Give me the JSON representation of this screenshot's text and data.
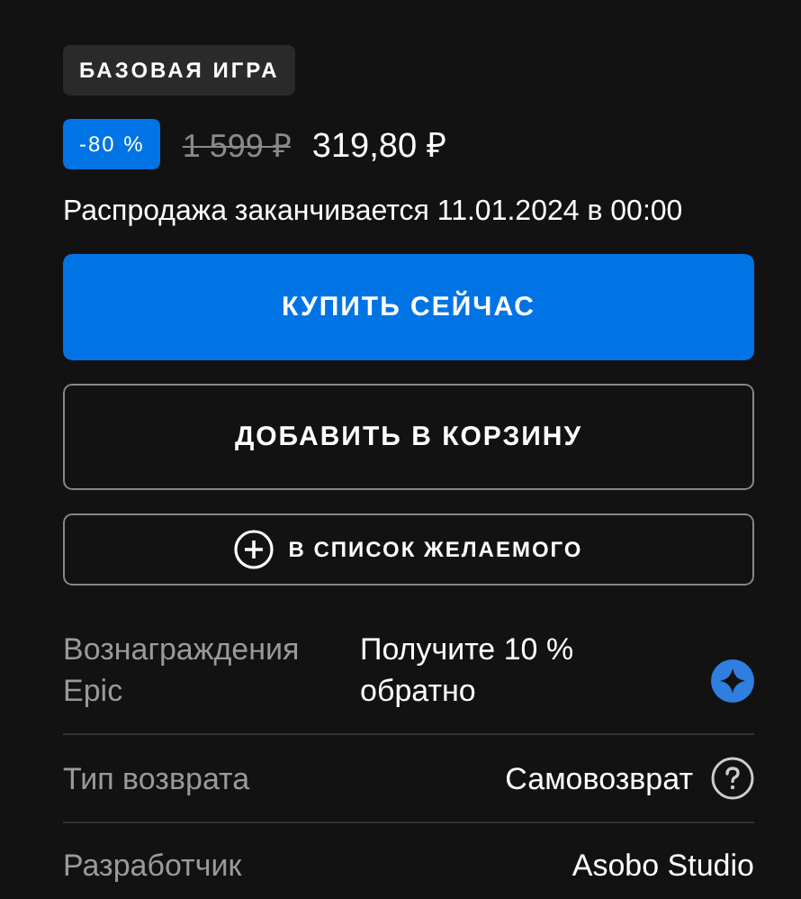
{
  "edition_badge": "БАЗОВАЯ ИГРА",
  "price": {
    "discount": "-80 %",
    "original": "1 599 ₽",
    "current": "319,80 ₽"
  },
  "sale_notice": "Распродажа заканчивается 11.01.2024 в 00:00",
  "buttons": [
    {
      "kind": "primary",
      "label": "КУПИТЬ СЕЙЧАС"
    },
    {
      "kind": "outline",
      "label": "ДОБАВИТЬ В КОРЗИНУ"
    },
    {
      "kind": "wishlist",
      "label": "В СПИСОК ЖЕЛАЕМОГО"
    }
  ],
  "details": [
    {
      "kind": "rewards",
      "label": "Вознаграждения Epic",
      "value": "Получите 10 % обратно"
    },
    {
      "kind": "help",
      "label": "Тип возврата",
      "value": "Самовозврат"
    },
    {
      "kind": "plain",
      "label": "Разработчик",
      "value": "Asobo Studio"
    }
  ]
}
